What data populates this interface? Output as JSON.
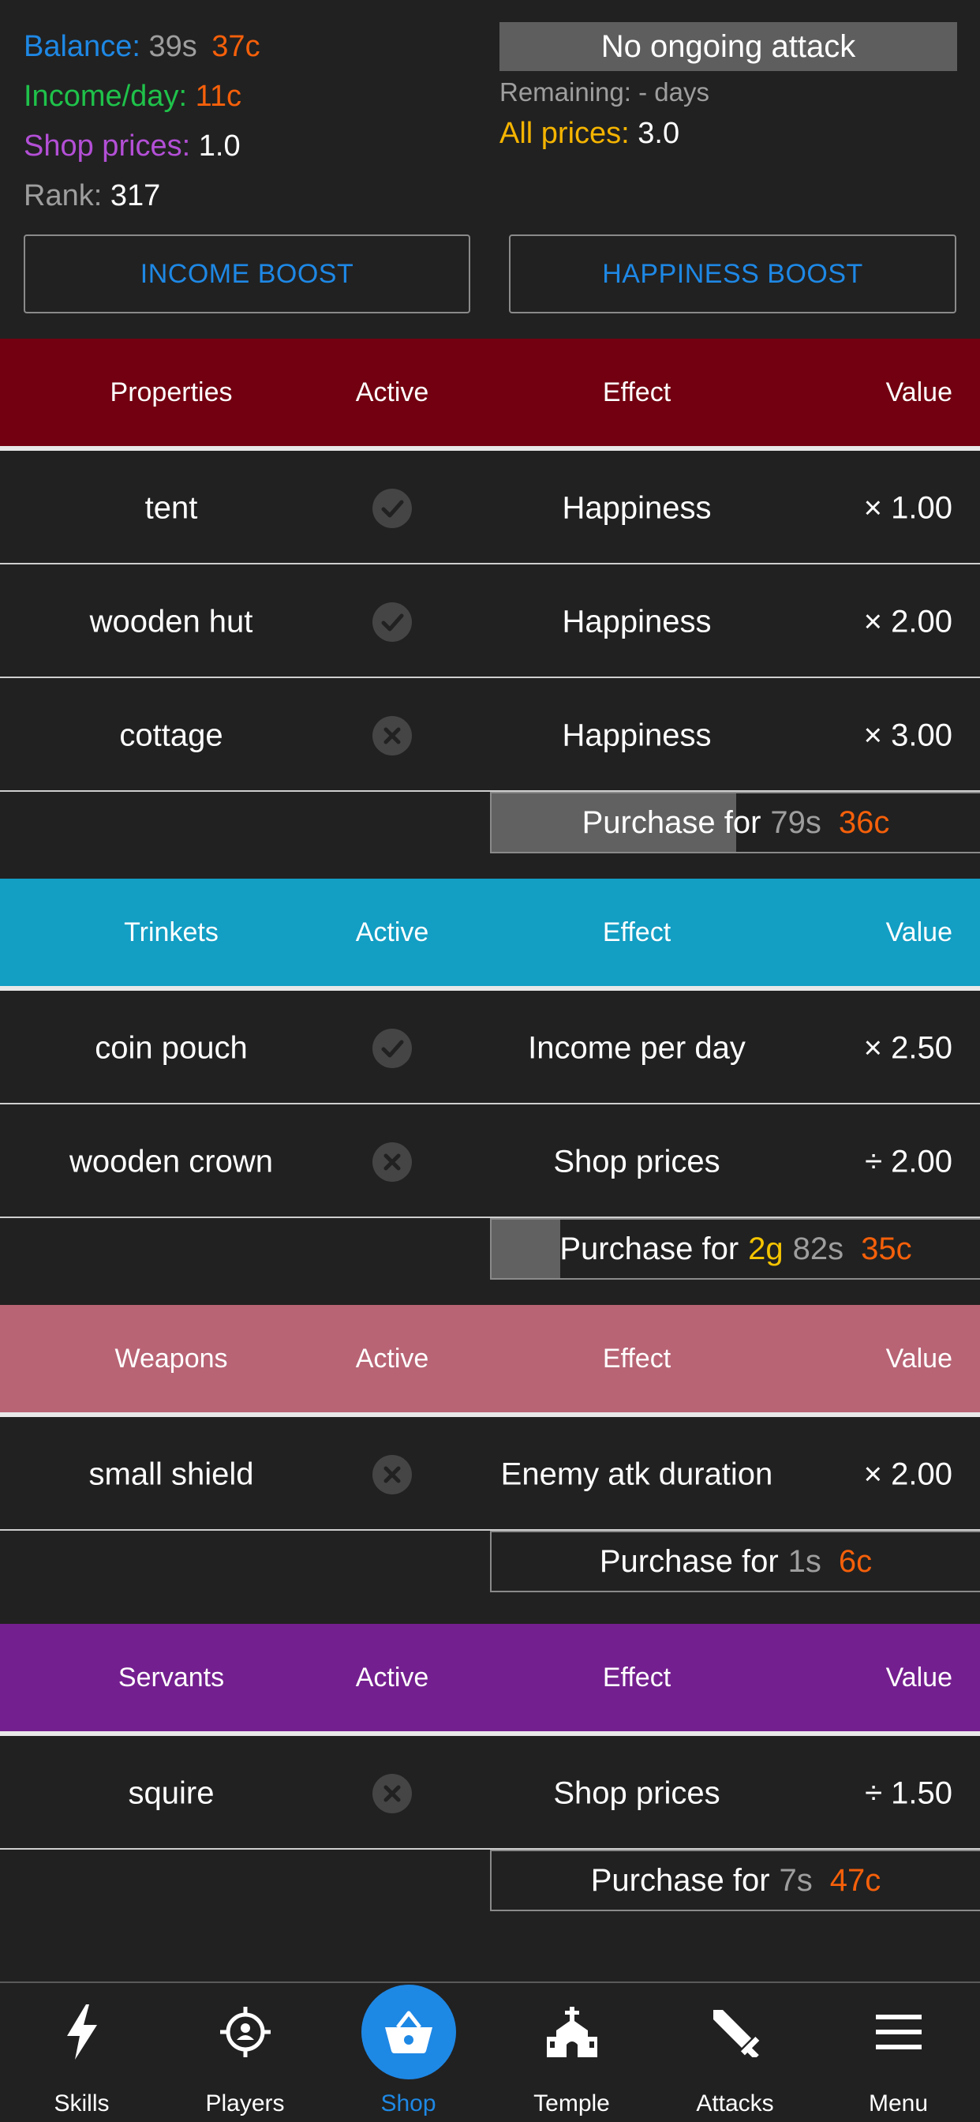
{
  "stats": {
    "balance_label": "Balance:",
    "balance_s": "39s",
    "balance_c": "37c",
    "income_label": "Income/day:",
    "income_value": "11c",
    "shop_prices_label": "Shop prices:",
    "shop_prices_value": "1.0",
    "rank_label": "Rank:",
    "rank_value": "317"
  },
  "attack": {
    "status": "No ongoing attack",
    "remaining": "Remaining: - days",
    "all_prices_label": "All prices:",
    "all_prices_value": "3.0"
  },
  "boosts": {
    "income": "INCOME BOOST",
    "happiness": "HAPPINESS BOOST"
  },
  "columns": {
    "active": "Active",
    "effect": "Effect",
    "value": "Value"
  },
  "properties": {
    "title": "Properties",
    "color": "#720010",
    "items": [
      {
        "name": "tent",
        "active": true,
        "effect": "Happiness",
        "value": "× 1.00"
      },
      {
        "name": "wooden hut",
        "active": true,
        "effect": "Happiness",
        "value": "× 2.00"
      },
      {
        "name": "cottage",
        "active": false,
        "effect": "Happiness",
        "value": "× 3.00"
      }
    ],
    "purchase": {
      "label": "Purchase for",
      "s": "79s",
      "c": "36c",
      "progress": 0.5
    }
  },
  "trinkets": {
    "title": "Trinkets",
    "color": "#139ec4",
    "items": [
      {
        "name": "coin pouch",
        "active": true,
        "effect": "Income per day",
        "value": "× 2.50"
      },
      {
        "name": "wooden crown",
        "active": false,
        "effect": "Shop prices",
        "value": "÷ 2.00"
      }
    ],
    "purchase": {
      "label": "Purchase for",
      "g": "2g",
      "s": "82s",
      "c": "35c",
      "progress": 0.14
    }
  },
  "weapons": {
    "title": "Weapons",
    "color": "#b86475",
    "items": [
      {
        "name": "small shield",
        "active": false,
        "effect": "Enemy atk duration",
        "value": "× 2.00"
      }
    ],
    "purchase": {
      "label": "Purchase for",
      "s": "1s",
      "c": "6c",
      "progress": 0
    }
  },
  "servants": {
    "title": "Servants",
    "color": "#741f8f",
    "items": [
      {
        "name": "squire",
        "active": false,
        "effect": "Shop prices",
        "value": "÷ 1.50"
      }
    ],
    "purchase": {
      "label": "Purchase for",
      "s": "7s",
      "c": "47c",
      "progress": 0
    }
  },
  "nav": [
    {
      "label": "Skills",
      "icon": "lightning-icon",
      "active": false
    },
    {
      "label": "Players",
      "icon": "target-person-icon",
      "active": false
    },
    {
      "label": "Shop",
      "icon": "basket-icon",
      "active": true
    },
    {
      "label": "Temple",
      "icon": "church-icon",
      "active": false
    },
    {
      "label": "Attacks",
      "icon": "sword-icon",
      "active": false
    },
    {
      "label": "Menu",
      "icon": "hamburger-menu-icon",
      "active": false
    }
  ]
}
